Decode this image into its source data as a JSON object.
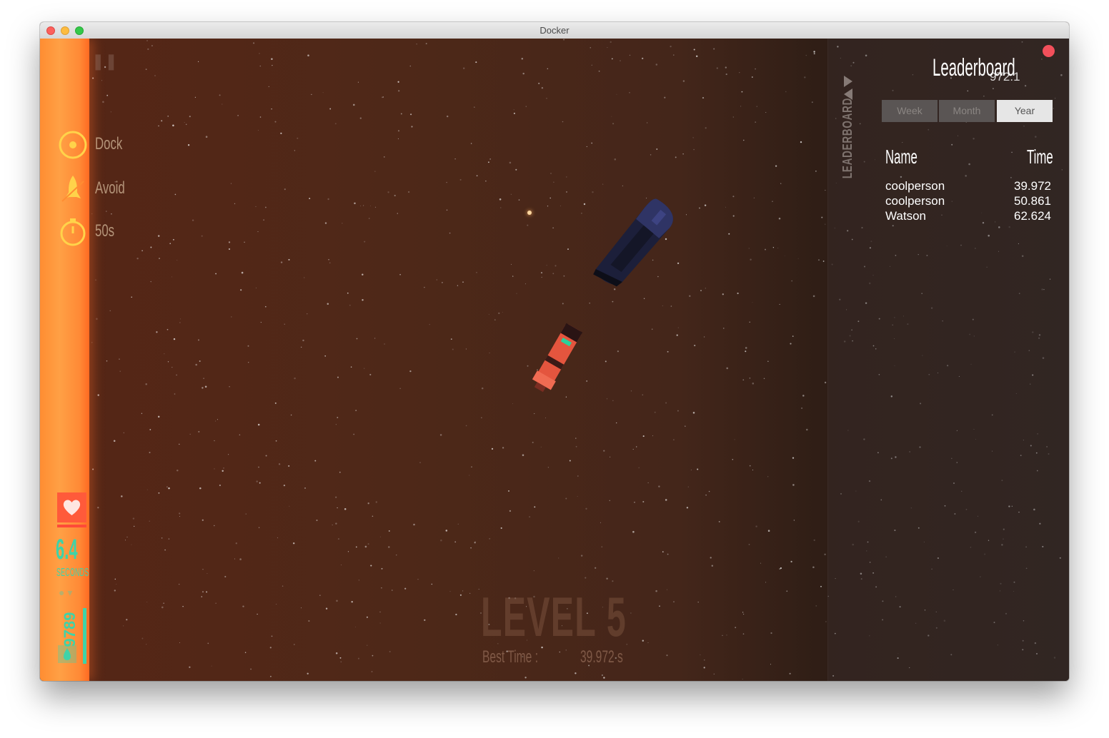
{
  "window": {
    "title": "Docker"
  },
  "hud": {
    "objectives": [
      {
        "icon": "target-icon",
        "label": "Dock"
      },
      {
        "icon": "rocket-icon",
        "label": "Avoid"
      },
      {
        "icon": "stopwatch-icon",
        "label": "50s"
      }
    ],
    "time_value": "6.4",
    "time_unit": "SECONDS",
    "fuel_value": "9789",
    "colors": {
      "sun": "#ff8d32",
      "hud_accent": "#3ed3a8",
      "health": "#ff5a3a"
    }
  },
  "level": {
    "title": "LEVEL 5",
    "best_time_label": "Best Time :",
    "best_time_value": "39.972 s"
  },
  "leaderboard": {
    "title": "Leaderboard",
    "subtitle": "972.1",
    "side_label": "LEADERBOARD",
    "tabs": [
      {
        "label": "Week",
        "active": false
      },
      {
        "label": "Month",
        "active": false
      },
      {
        "label": "Year",
        "active": true
      }
    ],
    "columns": {
      "name": "Name",
      "time": "Time"
    },
    "rows": [
      {
        "name": "coolperson",
        "time": "39.972"
      },
      {
        "name": "coolperson",
        "time": "50.861"
      },
      {
        "name": "Watson",
        "time": "62.624"
      }
    ]
  }
}
